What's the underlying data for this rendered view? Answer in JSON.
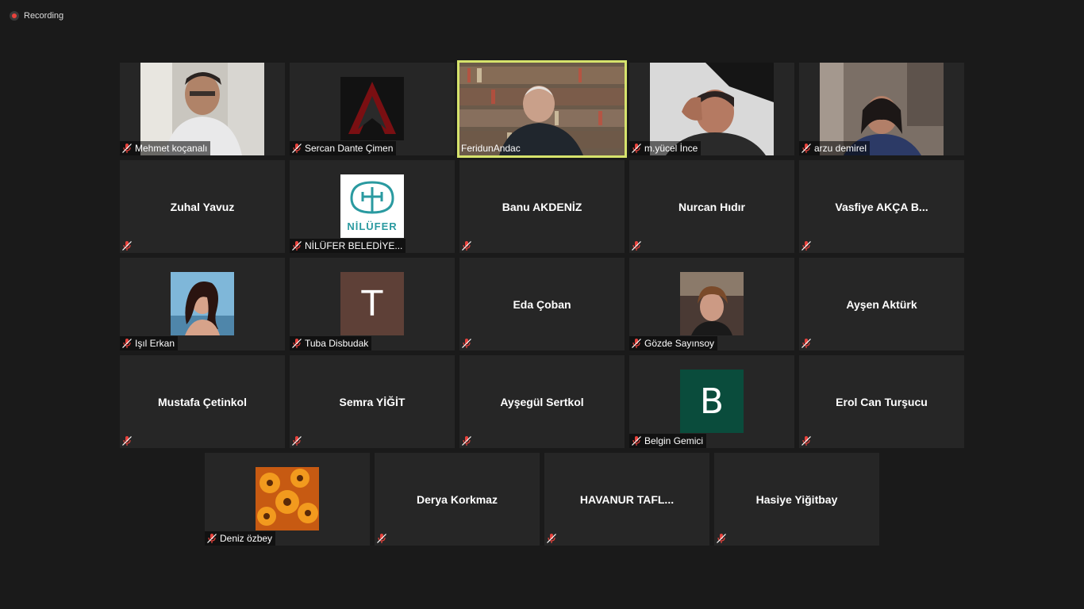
{
  "recording": {
    "label": "Recording"
  },
  "participants": [
    {
      "name": "Mehmet koçanalı",
      "display": "",
      "type": "video"
    },
    {
      "name": "Sercan Dante Çimen",
      "display": "",
      "type": "image"
    },
    {
      "name": "FeridunAndac",
      "display": "",
      "type": "video",
      "speaking": true
    },
    {
      "name": "m.yücel İnce",
      "display": "",
      "type": "video"
    },
    {
      "name": "arzu demirel",
      "display": "",
      "type": "video"
    },
    {
      "name": "",
      "display": "Zuhal Yavuz",
      "type": "name"
    },
    {
      "name": "NİLÜFER BELEDİYE...",
      "display": "",
      "type": "image",
      "logo_text": "NİLÜFER"
    },
    {
      "name": "",
      "display": "Banu AKDENİZ",
      "type": "name"
    },
    {
      "name": "",
      "display": "Nurcan Hıdır",
      "type": "name"
    },
    {
      "name": "",
      "display": "Vasfiye AKÇA B...",
      "type": "name"
    },
    {
      "name": "Işıl Erkan",
      "display": "",
      "type": "image"
    },
    {
      "name": "Tuba Disbudak",
      "display": "",
      "type": "initial",
      "initial": "T",
      "color": "#5e4037"
    },
    {
      "name": "",
      "display": "Eda Çoban",
      "type": "name"
    },
    {
      "name": "Gözde Sayınsoy",
      "display": "",
      "type": "image"
    },
    {
      "name": "",
      "display": "Ayşen Aktürk",
      "type": "name"
    },
    {
      "name": "",
      "display": "Mustafa Çetinkol",
      "type": "name"
    },
    {
      "name": "",
      "display": "Semra YİĞİT",
      "type": "name"
    },
    {
      "name": "",
      "display": "Ayşegül Sertkol",
      "type": "name"
    },
    {
      "name": "Belgin Gemici",
      "display": "",
      "type": "initial",
      "initial": "B",
      "color": "#0a4c3c"
    },
    {
      "name": "",
      "display": "Erol Can Turşucu",
      "type": "name"
    },
    {
      "name": "Deniz özbey",
      "display": "",
      "type": "image"
    },
    {
      "name": "",
      "display": "Derya Korkmaz",
      "type": "name"
    },
    {
      "name": "",
      "display": "HAVANUR TAFL...",
      "type": "name"
    },
    {
      "name": "",
      "display": "Hasiye Yiğitbay",
      "type": "name"
    }
  ],
  "colors": {
    "background": "#1a1a1a",
    "tile": "#262626",
    "speaker_border": "#d6e36c",
    "muted_mic": "#e8423c"
  }
}
